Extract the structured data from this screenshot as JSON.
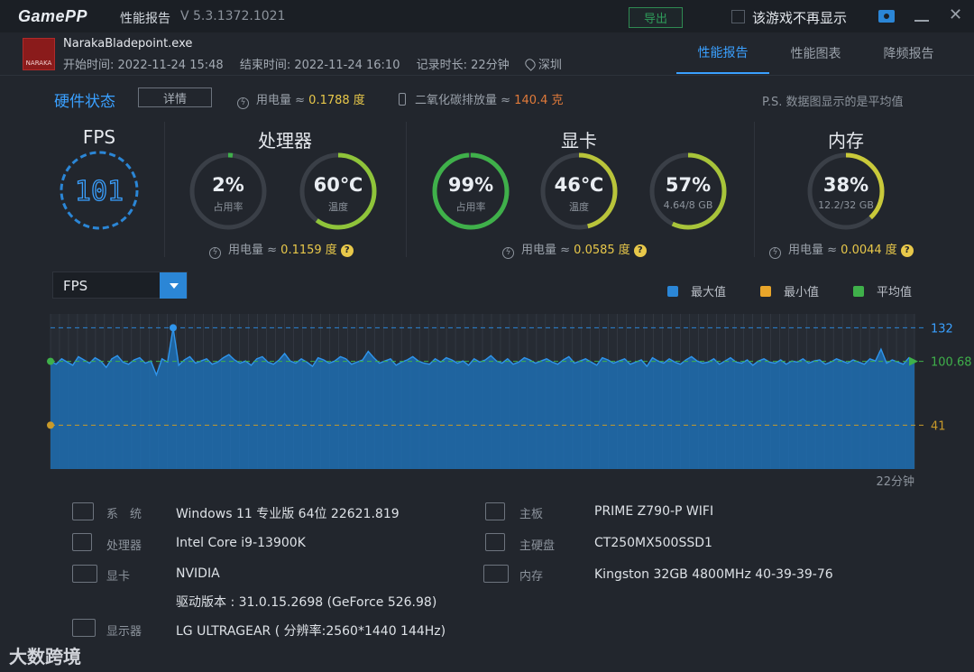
{
  "titlebar": {
    "logo": "GamePP",
    "title": "性能报告",
    "version": "V 5.3.1372.1021",
    "export_label": "导出",
    "dont_show_label": "该游戏不再显示",
    "minimize": "—",
    "close": "✕"
  },
  "app": {
    "icon_text": "NARAKA",
    "name": "NarakaBladepoint.exe",
    "start": "开始时间: 2022-11-24 15:48",
    "end": "结束时间: 2022-11-24 16:10",
    "duration": "记录时长: 22分钟",
    "location": "深圳"
  },
  "tabs": [
    "性能报告",
    "性能图表",
    "降频报告"
  ],
  "hw": {
    "title": "硬件状态",
    "detail_label": "详情",
    "power_label": "用电量 ≈ ",
    "power_value": "0.1788 度",
    "co2_label": "二氧化碳排放量 ≈ ",
    "co2_value": "140.4 克",
    "note": "P.S. 数据图显示的是平均值"
  },
  "sections": {
    "fps": {
      "title": "FPS",
      "value": "101"
    },
    "cpu": {
      "title": "处理器",
      "usage": "2%",
      "usage_label": "占用率",
      "usage_pct": 2,
      "temp": "60℃",
      "temp_label": "温度",
      "temp_pct": 60,
      "power_label": "用电量 ≈ ",
      "power_value": "0.1159 度"
    },
    "gpu": {
      "title": "显卡",
      "usage": "99%",
      "usage_label": "占用率",
      "usage_pct": 99,
      "temp": "46℃",
      "temp_label": "温度",
      "temp_pct": 46,
      "vram": "57%",
      "vram_label": "4.64/8 GB",
      "vram_pct": 57,
      "power_label": "用电量 ≈ ",
      "power_value": "0.0585 度"
    },
    "mem": {
      "title": "内存",
      "usage": "38%",
      "usage_label": "12.2/32 GB",
      "usage_pct": 38,
      "power_label": "用电量 ≈ ",
      "power_value": "0.0044 度"
    }
  },
  "chart_controls": {
    "metric": "FPS",
    "legend": [
      {
        "name": "最大值",
        "color": "#2b86d6"
      },
      {
        "name": "最小值",
        "color": "#e8a52a"
      },
      {
        "name": "平均值",
        "color": "#3fb04a"
      }
    ]
  },
  "chart_data": {
    "type": "area",
    "series_label": "FPS",
    "max": 132,
    "min": 41,
    "avg": 100.68,
    "max_label": "132",
    "avg_label": "100.68",
    "min_label": "41",
    "x_end_label": "22分钟",
    "values": [
      101,
      98,
      103,
      100,
      97,
      105,
      102,
      99,
      104,
      101,
      95,
      103,
      106,
      100,
      98,
      102,
      104,
      99,
      101,
      88,
      103,
      100,
      132,
      97,
      102,
      105,
      99,
      101,
      103,
      98,
      100,
      104,
      107,
      102,
      99,
      101,
      97,
      103,
      105,
      100,
      98,
      102,
      108,
      101,
      99,
      103,
      100,
      96,
      104,
      102,
      99,
      101,
      105,
      103,
      98,
      100,
      102,
      110,
      104,
      99,
      101,
      103,
      97,
      100,
      102,
      105,
      101,
      99,
      98,
      103,
      100,
      104,
      102,
      99,
      101,
      97,
      103,
      100,
      102,
      106,
      101,
      99,
      103,
      98,
      100,
      104,
      102,
      99,
      101,
      103,
      100,
      98,
      102,
      105,
      99,
      101,
      103,
      100,
      97,
      104,
      102,
      99,
      101,
      103,
      98,
      100,
      102,
      96,
      104,
      101,
      99,
      103,
      100,
      98,
      102,
      105,
      101,
      99,
      100,
      103,
      98,
      101,
      104,
      100,
      99,
      102,
      97,
      101,
      103,
      100,
      99,
      102,
      98,
      101,
      100,
      103,
      99,
      101,
      102,
      98,
      100,
      103,
      101,
      99,
      102,
      100,
      98,
      103,
      101,
      112,
      99,
      102,
      100,
      98,
      104,
      101
    ]
  },
  "system": [
    {
      "icon": "windows-icon",
      "key": "系　统",
      "value": "Windows 11 专业版 64位 22621.819"
    },
    {
      "icon": "cpu-icon",
      "key": "处理器",
      "value": "Intel Core i9-13900K"
    },
    {
      "icon": "gpu-icon",
      "key": "显卡",
      "value": "NVIDIA",
      "extra": "驱动版本 : 31.0.15.2698 (GeForce 526.98)"
    },
    {
      "icon": "monitor-icon",
      "key": "显示器",
      "value": "LG ULTRAGEAR ( 分辨率:2560*1440 144Hz)"
    },
    {
      "icon": "motherboard-icon",
      "key": "主板",
      "value": "PRIME Z790-P WIFI"
    },
    {
      "icon": "disk-icon",
      "key": "主硬盘",
      "value": "CT250MX500SSD1"
    },
    {
      "icon": "memory-icon",
      "key": "内存",
      "value": "Kingston 32GB 4800MHz 40-39-39-76"
    }
  ],
  "watermark": "大数跨境",
  "colors": {
    "accent": "#3aa0ff",
    "power": "#e8c84a",
    "co2": "#e07a3a",
    "gauge_green": "#3fb04a",
    "gauge_yellow": "#c9c93a"
  }
}
